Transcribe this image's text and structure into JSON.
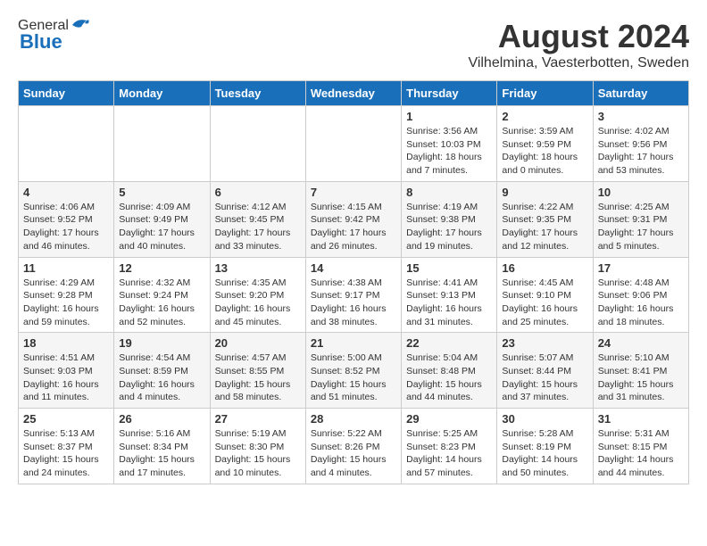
{
  "header": {
    "logo_general": "General",
    "logo_blue": "Blue",
    "month": "August 2024",
    "location": "Vilhelmina, Vaesterbotten, Sweden"
  },
  "weekdays": [
    "Sunday",
    "Monday",
    "Tuesday",
    "Wednesday",
    "Thursday",
    "Friday",
    "Saturday"
  ],
  "weeks": [
    [
      {
        "day": "",
        "info": ""
      },
      {
        "day": "",
        "info": ""
      },
      {
        "day": "",
        "info": ""
      },
      {
        "day": "",
        "info": ""
      },
      {
        "day": "1",
        "info": "Sunrise: 3:56 AM\nSunset: 10:03 PM\nDaylight: 18 hours\nand 7 minutes."
      },
      {
        "day": "2",
        "info": "Sunrise: 3:59 AM\nSunset: 9:59 PM\nDaylight: 18 hours\nand 0 minutes."
      },
      {
        "day": "3",
        "info": "Sunrise: 4:02 AM\nSunset: 9:56 PM\nDaylight: 17 hours\nand 53 minutes."
      }
    ],
    [
      {
        "day": "4",
        "info": "Sunrise: 4:06 AM\nSunset: 9:52 PM\nDaylight: 17 hours\nand 46 minutes."
      },
      {
        "day": "5",
        "info": "Sunrise: 4:09 AM\nSunset: 9:49 PM\nDaylight: 17 hours\nand 40 minutes."
      },
      {
        "day": "6",
        "info": "Sunrise: 4:12 AM\nSunset: 9:45 PM\nDaylight: 17 hours\nand 33 minutes."
      },
      {
        "day": "7",
        "info": "Sunrise: 4:15 AM\nSunset: 9:42 PM\nDaylight: 17 hours\nand 26 minutes."
      },
      {
        "day": "8",
        "info": "Sunrise: 4:19 AM\nSunset: 9:38 PM\nDaylight: 17 hours\nand 19 minutes."
      },
      {
        "day": "9",
        "info": "Sunrise: 4:22 AM\nSunset: 9:35 PM\nDaylight: 17 hours\nand 12 minutes."
      },
      {
        "day": "10",
        "info": "Sunrise: 4:25 AM\nSunset: 9:31 PM\nDaylight: 17 hours\nand 5 minutes."
      }
    ],
    [
      {
        "day": "11",
        "info": "Sunrise: 4:29 AM\nSunset: 9:28 PM\nDaylight: 16 hours\nand 59 minutes."
      },
      {
        "day": "12",
        "info": "Sunrise: 4:32 AM\nSunset: 9:24 PM\nDaylight: 16 hours\nand 52 minutes."
      },
      {
        "day": "13",
        "info": "Sunrise: 4:35 AM\nSunset: 9:20 PM\nDaylight: 16 hours\nand 45 minutes."
      },
      {
        "day": "14",
        "info": "Sunrise: 4:38 AM\nSunset: 9:17 PM\nDaylight: 16 hours\nand 38 minutes."
      },
      {
        "day": "15",
        "info": "Sunrise: 4:41 AM\nSunset: 9:13 PM\nDaylight: 16 hours\nand 31 minutes."
      },
      {
        "day": "16",
        "info": "Sunrise: 4:45 AM\nSunset: 9:10 PM\nDaylight: 16 hours\nand 25 minutes."
      },
      {
        "day": "17",
        "info": "Sunrise: 4:48 AM\nSunset: 9:06 PM\nDaylight: 16 hours\nand 18 minutes."
      }
    ],
    [
      {
        "day": "18",
        "info": "Sunrise: 4:51 AM\nSunset: 9:03 PM\nDaylight: 16 hours\nand 11 minutes."
      },
      {
        "day": "19",
        "info": "Sunrise: 4:54 AM\nSunset: 8:59 PM\nDaylight: 16 hours\nand 4 minutes."
      },
      {
        "day": "20",
        "info": "Sunrise: 4:57 AM\nSunset: 8:55 PM\nDaylight: 15 hours\nand 58 minutes."
      },
      {
        "day": "21",
        "info": "Sunrise: 5:00 AM\nSunset: 8:52 PM\nDaylight: 15 hours\nand 51 minutes."
      },
      {
        "day": "22",
        "info": "Sunrise: 5:04 AM\nSunset: 8:48 PM\nDaylight: 15 hours\nand 44 minutes."
      },
      {
        "day": "23",
        "info": "Sunrise: 5:07 AM\nSunset: 8:44 PM\nDaylight: 15 hours\nand 37 minutes."
      },
      {
        "day": "24",
        "info": "Sunrise: 5:10 AM\nSunset: 8:41 PM\nDaylight: 15 hours\nand 31 minutes."
      }
    ],
    [
      {
        "day": "25",
        "info": "Sunrise: 5:13 AM\nSunset: 8:37 PM\nDaylight: 15 hours\nand 24 minutes."
      },
      {
        "day": "26",
        "info": "Sunrise: 5:16 AM\nSunset: 8:34 PM\nDaylight: 15 hours\nand 17 minutes."
      },
      {
        "day": "27",
        "info": "Sunrise: 5:19 AM\nSunset: 8:30 PM\nDaylight: 15 hours\nand 10 minutes."
      },
      {
        "day": "28",
        "info": "Sunrise: 5:22 AM\nSunset: 8:26 PM\nDaylight: 15 hours\nand 4 minutes."
      },
      {
        "day": "29",
        "info": "Sunrise: 5:25 AM\nSunset: 8:23 PM\nDaylight: 14 hours\nand 57 minutes."
      },
      {
        "day": "30",
        "info": "Sunrise: 5:28 AM\nSunset: 8:19 PM\nDaylight: 14 hours\nand 50 minutes."
      },
      {
        "day": "31",
        "info": "Sunrise: 5:31 AM\nSunset: 8:15 PM\nDaylight: 14 hours\nand 44 minutes."
      }
    ]
  ]
}
